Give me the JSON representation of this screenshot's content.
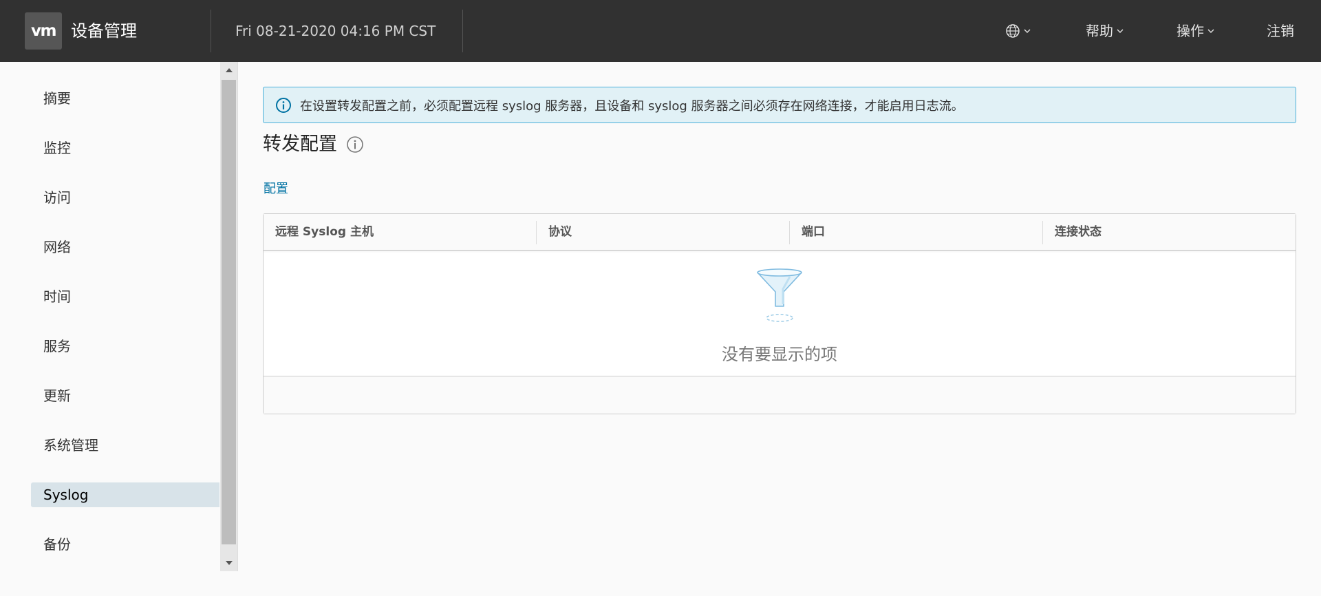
{
  "header": {
    "logo_text": "vm",
    "app_title": "设备管理",
    "datetime": "Fri 08-21-2020 04:16 PM CST",
    "language_icon": "globe-icon",
    "help_label": "帮助",
    "actions_label": "操作",
    "logout_label": "注销"
  },
  "sidebar": {
    "items": [
      {
        "label": "摘要"
      },
      {
        "label": "监控"
      },
      {
        "label": "访问"
      },
      {
        "label": "网络"
      },
      {
        "label": "时间"
      },
      {
        "label": "服务"
      },
      {
        "label": "更新"
      },
      {
        "label": "系统管理"
      },
      {
        "label": "Syslog",
        "active": true
      },
      {
        "label": "备份"
      }
    ]
  },
  "main": {
    "alert": {
      "icon": "info-icon",
      "text": "在设置转发配置之前，必须配置远程 syslog 服务器，且设备和 syslog 服务器之间必须存在网络连接，才能启用日志流。"
    },
    "section_title": "转发配置",
    "config_link": "配置",
    "table": {
      "columns": [
        "远程 Syslog 主机",
        "协议",
        "端口",
        "连接状态"
      ],
      "rows": [],
      "empty_text": "没有要显示的项",
      "empty_icon": "funnel-icon"
    }
  },
  "colors": {
    "header_bg": "#313131",
    "alert_bg": "#e1f1f6",
    "alert_border": "#49afd9",
    "link": "#0072a3",
    "active_nav_bg": "#d8e3e9"
  }
}
